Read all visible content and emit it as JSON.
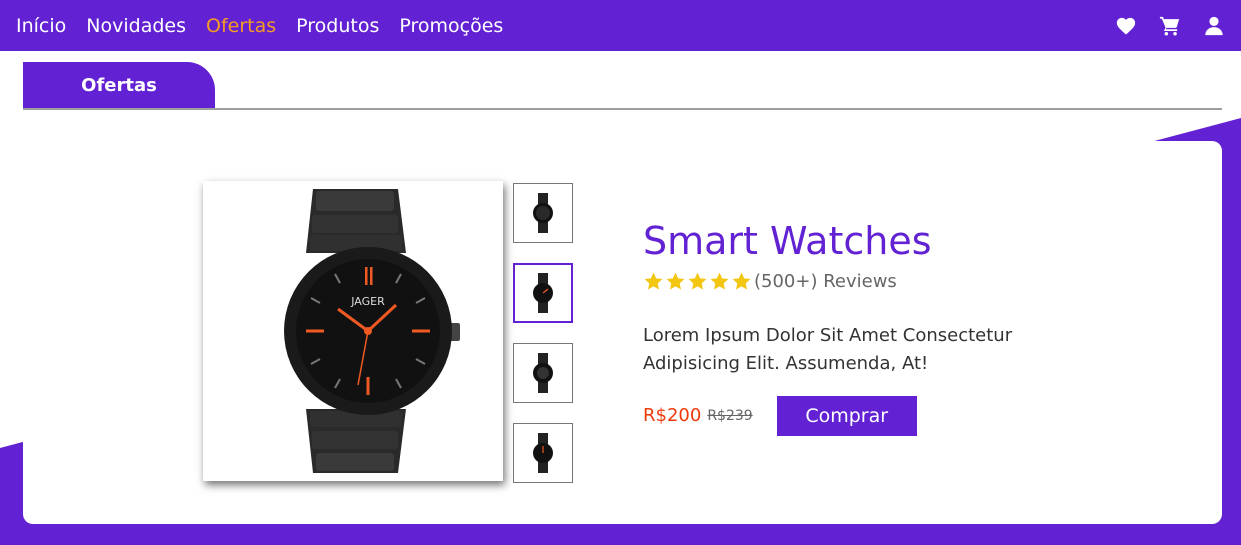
{
  "nav": {
    "links": [
      {
        "label": "Início"
      },
      {
        "label": "Novidades"
      },
      {
        "label": "Ofertas"
      },
      {
        "label": "Produtos"
      },
      {
        "label": "Promoções"
      }
    ],
    "active_color": "#f59a23",
    "icons": [
      "heart-icon",
      "cart-icon",
      "user-icon"
    ]
  },
  "tab": {
    "label": "Ofertas"
  },
  "product": {
    "title": "Smart Watches",
    "rating": 5,
    "reviews": "(500+) Reviews",
    "description": "Lorem Ipsum Dolor Sit Amet Consectetur Adipisicing Elit. Assumenda, At!",
    "price": "R$200",
    "old_price": "R$239",
    "buy_label": "Comprar",
    "thumbnails": 4,
    "selected_thumbnail": 2,
    "brand_text": "JAGER"
  },
  "colors": {
    "brand": "#6222d3",
    "price": "#ef3a0c",
    "star": "#f2c611"
  }
}
